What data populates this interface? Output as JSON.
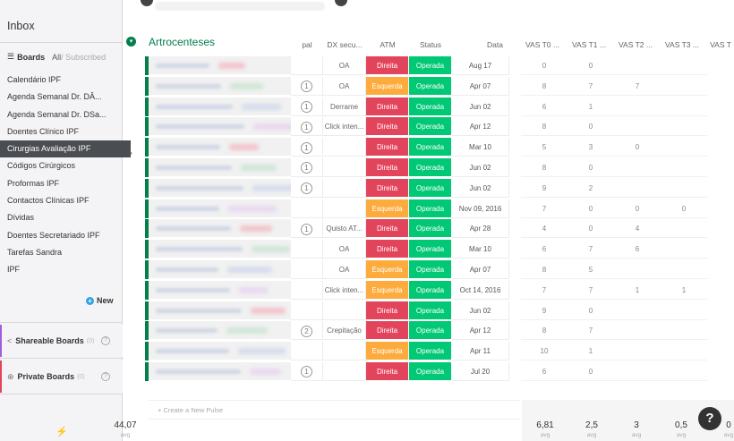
{
  "sidebar": {
    "inbox": "Inbox",
    "boards_label": "Boards",
    "all_label": "All",
    "subscribed_label": " / Subscribed",
    "items": [
      {
        "label": "Calendário IPF"
      },
      {
        "label": "Agenda Semanal Dr. DÂ..."
      },
      {
        "label": "Agenda Semanal Dr. DSa..."
      },
      {
        "label": "Doentes Clínico IPF"
      },
      {
        "label": "Cirurgias Avaliação IPF",
        "active": true
      },
      {
        "label": "Códigos Cirúrgicos"
      },
      {
        "label": "Proformas IPF"
      },
      {
        "label": "Contactos Clínicas IPF"
      },
      {
        "label": "Dívidas"
      },
      {
        "label": "Doentes Secretariado IPF"
      },
      {
        "label": "Tarefas Sandra"
      },
      {
        "label": "IPF"
      }
    ],
    "new_label": "New",
    "shareable": {
      "label": "Shareable Boards",
      "count": "(0)"
    },
    "private": {
      "label": "Private Boards",
      "count": "(0)"
    }
  },
  "group": {
    "title": "Artrocenteses",
    "color": "#037f4c",
    "columns": [
      {
        "label": "pal"
      },
      {
        "label": "DX secu..."
      },
      {
        "label": "ATM"
      },
      {
        "label": "Status"
      },
      {
        "label": "Data"
      },
      {
        "label": "VAS T0 ..."
      },
      {
        "label": "VAS T1 ..."
      },
      {
        "label": "VAS T2 ..."
      },
      {
        "label": "VAS T3 ..."
      },
      {
        "label": "VAS T"
      }
    ],
    "rows": [
      {
        "people": "",
        "dx": "OA",
        "atm": "Direita",
        "status": "Operada",
        "data": "Aug 17",
        "t0": "0",
        "t1": "0",
        "t2": "",
        "t3": ""
      },
      {
        "people": "1",
        "dx": "OA",
        "atm": "Esquerda",
        "status": "Operada",
        "data": "Apr 07",
        "t0": "8",
        "t1": "7",
        "t2": "7",
        "t3": ""
      },
      {
        "people": "1",
        "dx": "Derrame",
        "atm": "Direita",
        "status": "Operada",
        "data": "Jun 02",
        "t0": "6",
        "t1": "1",
        "t2": "",
        "t3": ""
      },
      {
        "people": "1",
        "dx": "Click inten...",
        "atm": "Direita",
        "status": "Operada",
        "data": "Apr 12",
        "t0": "8",
        "t1": "0",
        "t2": "",
        "t3": ""
      },
      {
        "people": "1",
        "dx": "",
        "atm": "Direita",
        "status": "Operada",
        "data": "Mar 10",
        "t0": "5",
        "t1": "3",
        "t2": "0",
        "t3": ""
      },
      {
        "people": "1",
        "dx": "",
        "atm": "Direita",
        "status": "Operada",
        "data": "Jun 02",
        "t0": "8",
        "t1": "0",
        "t2": "",
        "t3": ""
      },
      {
        "people": "1",
        "dx": "",
        "atm": "Direita",
        "status": "Operada",
        "data": "Jun 02",
        "t0": "9",
        "t1": "2",
        "t2": "",
        "t3": ""
      },
      {
        "people": "",
        "dx": "",
        "atm": "Esquerda",
        "status": "Operada",
        "data": "Nov 09, 2016",
        "t0": "7",
        "t1": "0",
        "t2": "0",
        "t3": "0"
      },
      {
        "people": "1",
        "dx": "Quisto AT...",
        "atm": "Direita",
        "status": "Operada",
        "data": "Apr 28",
        "t0": "4",
        "t1": "0",
        "t2": "4",
        "t3": ""
      },
      {
        "people": "",
        "dx": "OA",
        "atm": "Direita",
        "status": "Operada",
        "data": "Mar 10",
        "t0": "6",
        "t1": "7",
        "t2": "6",
        "t3": ""
      },
      {
        "people": "",
        "dx": "OA",
        "atm": "Esquerda",
        "status": "Operada",
        "data": "Apr 07",
        "t0": "8",
        "t1": "5",
        "t2": "",
        "t3": ""
      },
      {
        "people": "",
        "dx": "Click inten...",
        "atm": "Esquerda",
        "status": "Operada",
        "data": "Oct 14, 2016",
        "t0": "7",
        "t1": "7",
        "t2": "1",
        "t3": "1"
      },
      {
        "people": "",
        "dx": "",
        "atm": "Direita",
        "status": "Operada",
        "data": "Jun 02",
        "t0": "9",
        "t1": "0",
        "t2": "",
        "t3": ""
      },
      {
        "people": "2",
        "dx": "Crepitação",
        "atm": "Direita",
        "status": "Operada",
        "data": "Apr 12",
        "t0": "8",
        "t1": "7",
        "t2": "",
        "t3": ""
      },
      {
        "people": "",
        "dx": "",
        "atm": "Esquerda",
        "status": "Operada",
        "data": "Apr 11",
        "t0": "10",
        "t1": "1",
        "t2": "",
        "t3": ""
      },
      {
        "people": "1",
        "dx": "",
        "atm": "Direita",
        "status": "Operada",
        "data": "Jul 20",
        "t0": "6",
        "t1": "0",
        "t2": "",
        "t3": ""
      }
    ],
    "new_pulse": "+ Create a New Pulse",
    "summary": {
      "left": "44,07",
      "avg": "avg",
      "t0": "6,81",
      "t1": "2,5",
      "t2": "3",
      "t3": "0,5",
      "t4": "0"
    }
  },
  "colors": {
    "direita": "#e2445c",
    "esquerda": "#fdab3d",
    "operada": "#00c875",
    "group": "#037f4c",
    "active_board": "#4a4d52"
  },
  "help": "?"
}
